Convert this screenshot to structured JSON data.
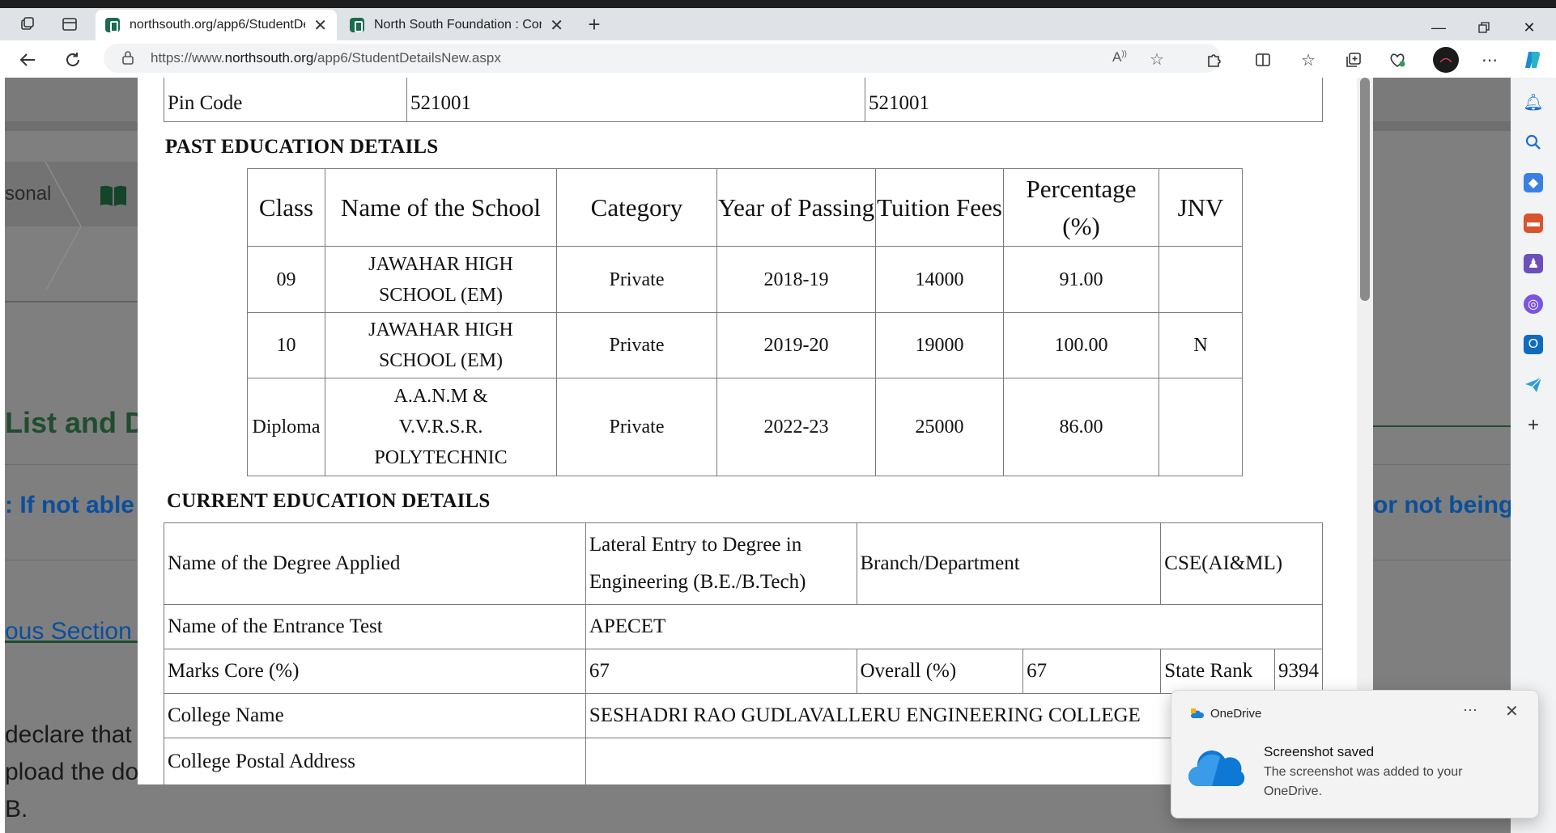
{
  "browser": {
    "tabs": [
      {
        "title": "northsouth.org/app6/StudentDe",
        "active": true
      },
      {
        "title": "North South Foundation : Contac",
        "active": false
      }
    ],
    "url_prefix": "https://www.",
    "url_domain": "northsouth.org",
    "url_path": "/app6/StudentDetailsNew.aspx"
  },
  "background": {
    "breadcrumb_partial": "sonal",
    "heading_partial": "List and D",
    "notice_left": ": If not able",
    "notice_right": "or not being",
    "section_link": "ous Section",
    "decl_line1": "declare that",
    "decl_line2": "pload the do",
    "decl_line3": "B."
  },
  "pin": {
    "label": "Pin Code",
    "value_1": "521001",
    "value_2": "521001"
  },
  "past_education": {
    "title": "PAST EDUCATION DETAILS",
    "headers": [
      "Class",
      "Name of the School",
      "Category",
      "Year of Passing",
      "Tuition Fees",
      "Percentage (%)",
      "JNV"
    ],
    "rows": [
      {
        "class": "09",
        "school": "JAWAHAR HIGH SCHOOL (EM)",
        "category": "Private",
        "year": "2018-19",
        "fees": "14000",
        "percentage": "91.00",
        "jnv": ""
      },
      {
        "class": "10",
        "school": "JAWAHAR HIGH SCHOOL (EM)",
        "category": "Private",
        "year": "2019-20",
        "fees": "19000",
        "percentage": "100.00",
        "jnv": "N"
      },
      {
        "class": "Diploma",
        "school": "A.A.N.M & V.V.R.S.R. POLYTECHNIC",
        "category": "Private",
        "year": "2022-23",
        "fees": "25000",
        "percentage": "86.00",
        "jnv": ""
      }
    ]
  },
  "current_education": {
    "title": "CURRENT EDUCATION DETAILS",
    "degree_label": "Name of the Degree Applied",
    "degree_value": "Lateral Entry to Degree in Engineering (B.E./B.Tech)",
    "branch_label": "Branch/Department",
    "branch_value": "CSE(AI&ML)",
    "entrance_label": "Name of the Entrance Test",
    "entrance_value": "APECET",
    "marks_core_label": "Marks Core (%)",
    "marks_core_value": "67",
    "overall_label": "Overall (%)",
    "overall_value": "67",
    "state_rank_label": "State Rank",
    "state_rank_value": "9394",
    "college_name_label": "College Name",
    "college_name_value": "SESHADRI RAO GUDLAVALLERU ENGINEERING COLLEGE",
    "college_address_label": "College Postal Address",
    "college_address_value": ""
  },
  "toast": {
    "app": "OneDrive",
    "title": "Screenshot saved",
    "message": "The screenshot was added to your OneDrive."
  },
  "colors": {
    "bg_overlay": "#7f7f7f",
    "bg_green": "#1f4d2e",
    "bg_link_blue": "#0b4f9c",
    "favicon_green": "#1c6b4f"
  }
}
